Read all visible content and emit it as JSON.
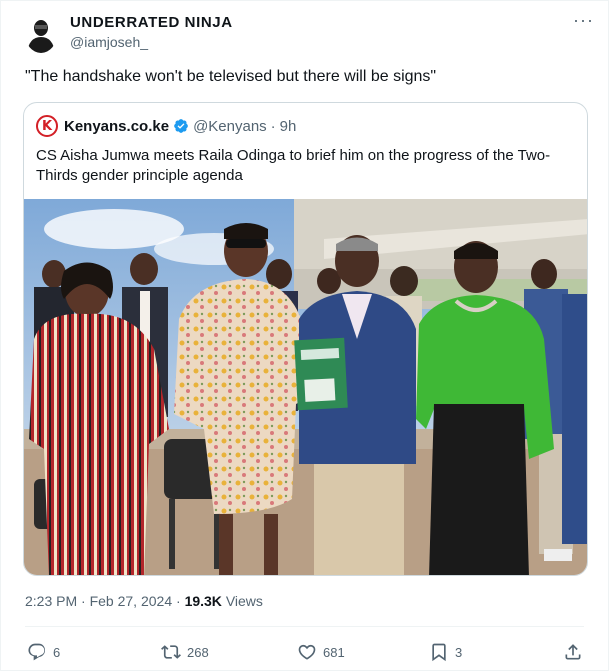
{
  "author": {
    "display_name": "UNDERRATED NINJA",
    "handle": "@iamjoseh_"
  },
  "tweet": {
    "text": "\"The handshake won't be televised but there will be signs\""
  },
  "quoted_tweet": {
    "source_name": "Kenyans.co.ke",
    "source_handle": "@Kenyans",
    "separator": "·",
    "age": "9h",
    "logo_letter": "K",
    "text": "CS Aisha Jumwa meets Raila Odinga to brief him on the progress of the Two-Thirds gender principle agenda"
  },
  "meta": {
    "time": "2:23 PM",
    "separator1": "·",
    "date": "Feb 27, 2024",
    "separator2": "·",
    "views_count": "19.3K",
    "views_label": "Views"
  },
  "actions": {
    "replies": "6",
    "reposts": "268",
    "likes": "681",
    "bookmarks": "3"
  },
  "icons": {
    "more": "more-icon",
    "verified": "verified-badge-icon",
    "reply": "reply-icon",
    "repost": "repost-icon",
    "like": "like-icon",
    "bookmark": "bookmark-icon",
    "share": "share-icon"
  },
  "colors": {
    "text_primary": "#0f1419",
    "text_secondary": "#536471",
    "verified_blue": "#1d9bf0",
    "border": "#cfd9de",
    "kenyans_red": "#d32027"
  }
}
